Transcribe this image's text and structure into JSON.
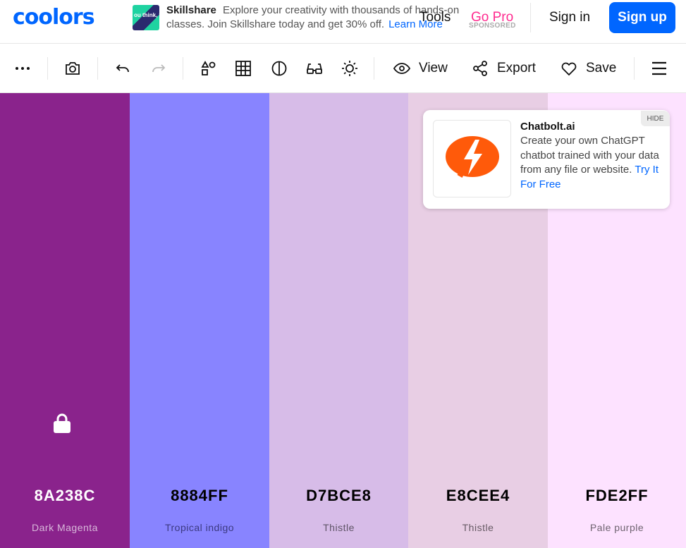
{
  "nav": {
    "logo": "coolors",
    "ad": {
      "brand": "Skillshare",
      "line1": "Explore your creativity with thousands of hands-on",
      "line2": "classes. Join Skillshare today and get 30% off.",
      "link": "Learn More",
      "sponsored": "SPONSORED",
      "thumb_text": "ou think, y"
    },
    "tools": "Tools",
    "go_pro": "Go Pro",
    "sign_in": "Sign in",
    "sign_up": "Sign up"
  },
  "toolbar": {
    "icons": [
      "more-options-icon",
      "camera-icon",
      "undo-icon",
      "redo-icon",
      "shapes-icon",
      "grid-icon",
      "contrast-icon",
      "glasses-icon",
      "sun-icon"
    ],
    "view": "View",
    "export": "Export",
    "save": "Save",
    "menu_icon": "hamburger-menu-icon"
  },
  "palette": [
    {
      "hex": "8A238C",
      "name": "Dark Magenta",
      "bg": "#8A238C",
      "text": "#ffffff",
      "name_color": "#d8b8da",
      "locked": true
    },
    {
      "hex": "8884FF",
      "name": "Tropical indigo",
      "bg": "#8884FF",
      "text": "#000000",
      "name_color": "#3b3980",
      "locked": false
    },
    {
      "hex": "D7BCE8",
      "name": "Thistle",
      "bg": "#D7BCE8",
      "text": "#000000",
      "name_color": "#5e5366",
      "locked": false
    },
    {
      "hex": "E8CEE4",
      "name": "Thistle",
      "bg": "#E8CEE4",
      "text": "#000000",
      "name_color": "#665a64",
      "locked": false
    },
    {
      "hex": "FDE2FF",
      "name": "Pale purple",
      "bg": "#FDE2FF",
      "text": "#000000",
      "name_color": "#6f6370",
      "locked": false
    }
  ],
  "float_ad": {
    "hide": "HIDE",
    "title": "Chatbolt.ai",
    "body": "Create your own ChatGPT chatbot trained with your data from any file or website.",
    "cta": "Try It For Free",
    "accent": "#ff5a0a"
  }
}
